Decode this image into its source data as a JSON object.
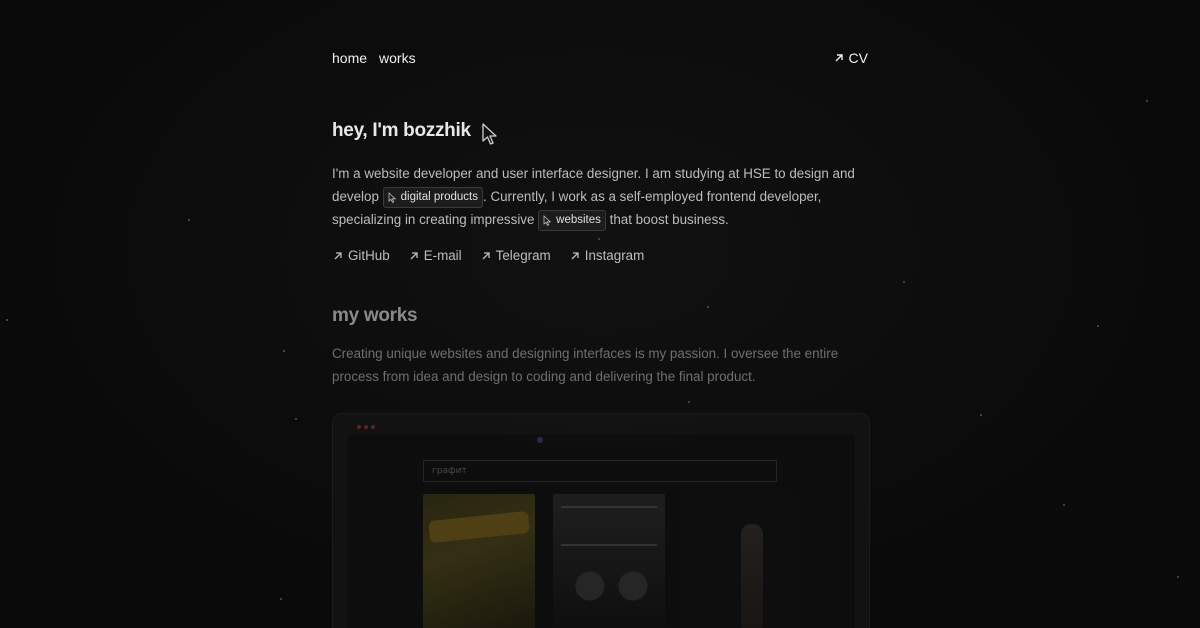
{
  "nav": {
    "home": "home",
    "works": "works",
    "cv": "CV"
  },
  "hero": {
    "title": "hey, I'm bozzhik",
    "bio_part1": "I'm a website developer and user interface designer. I am studying at HSE to design and develop ",
    "chip1": "digital products",
    "bio_part2": ". Currently, I work as a self-employed frontend developer, specializing in creating impressive ",
    "chip2": "websites",
    "bio_part3": " that boost business."
  },
  "socials": [
    {
      "label": "GitHub"
    },
    {
      "label": "E-mail"
    },
    {
      "label": "Telegram"
    },
    {
      "label": "Instagram"
    }
  ],
  "works": {
    "title": "my works",
    "description": "Creating unique websites and designing interfaces is my passion. I oversee the entire process from idea and design to coding and delivering the final product."
  },
  "preview": {
    "site_logo": "графит"
  },
  "colors": {
    "background": "#0b0b0b",
    "text_primary": "#e6e6e6",
    "text_secondary": "#bdbdbd",
    "text_muted": "#6f6f6f"
  },
  "icons": {
    "arrow": "arrow-up-right-icon",
    "cursor": "cursor-pointer-icon"
  }
}
